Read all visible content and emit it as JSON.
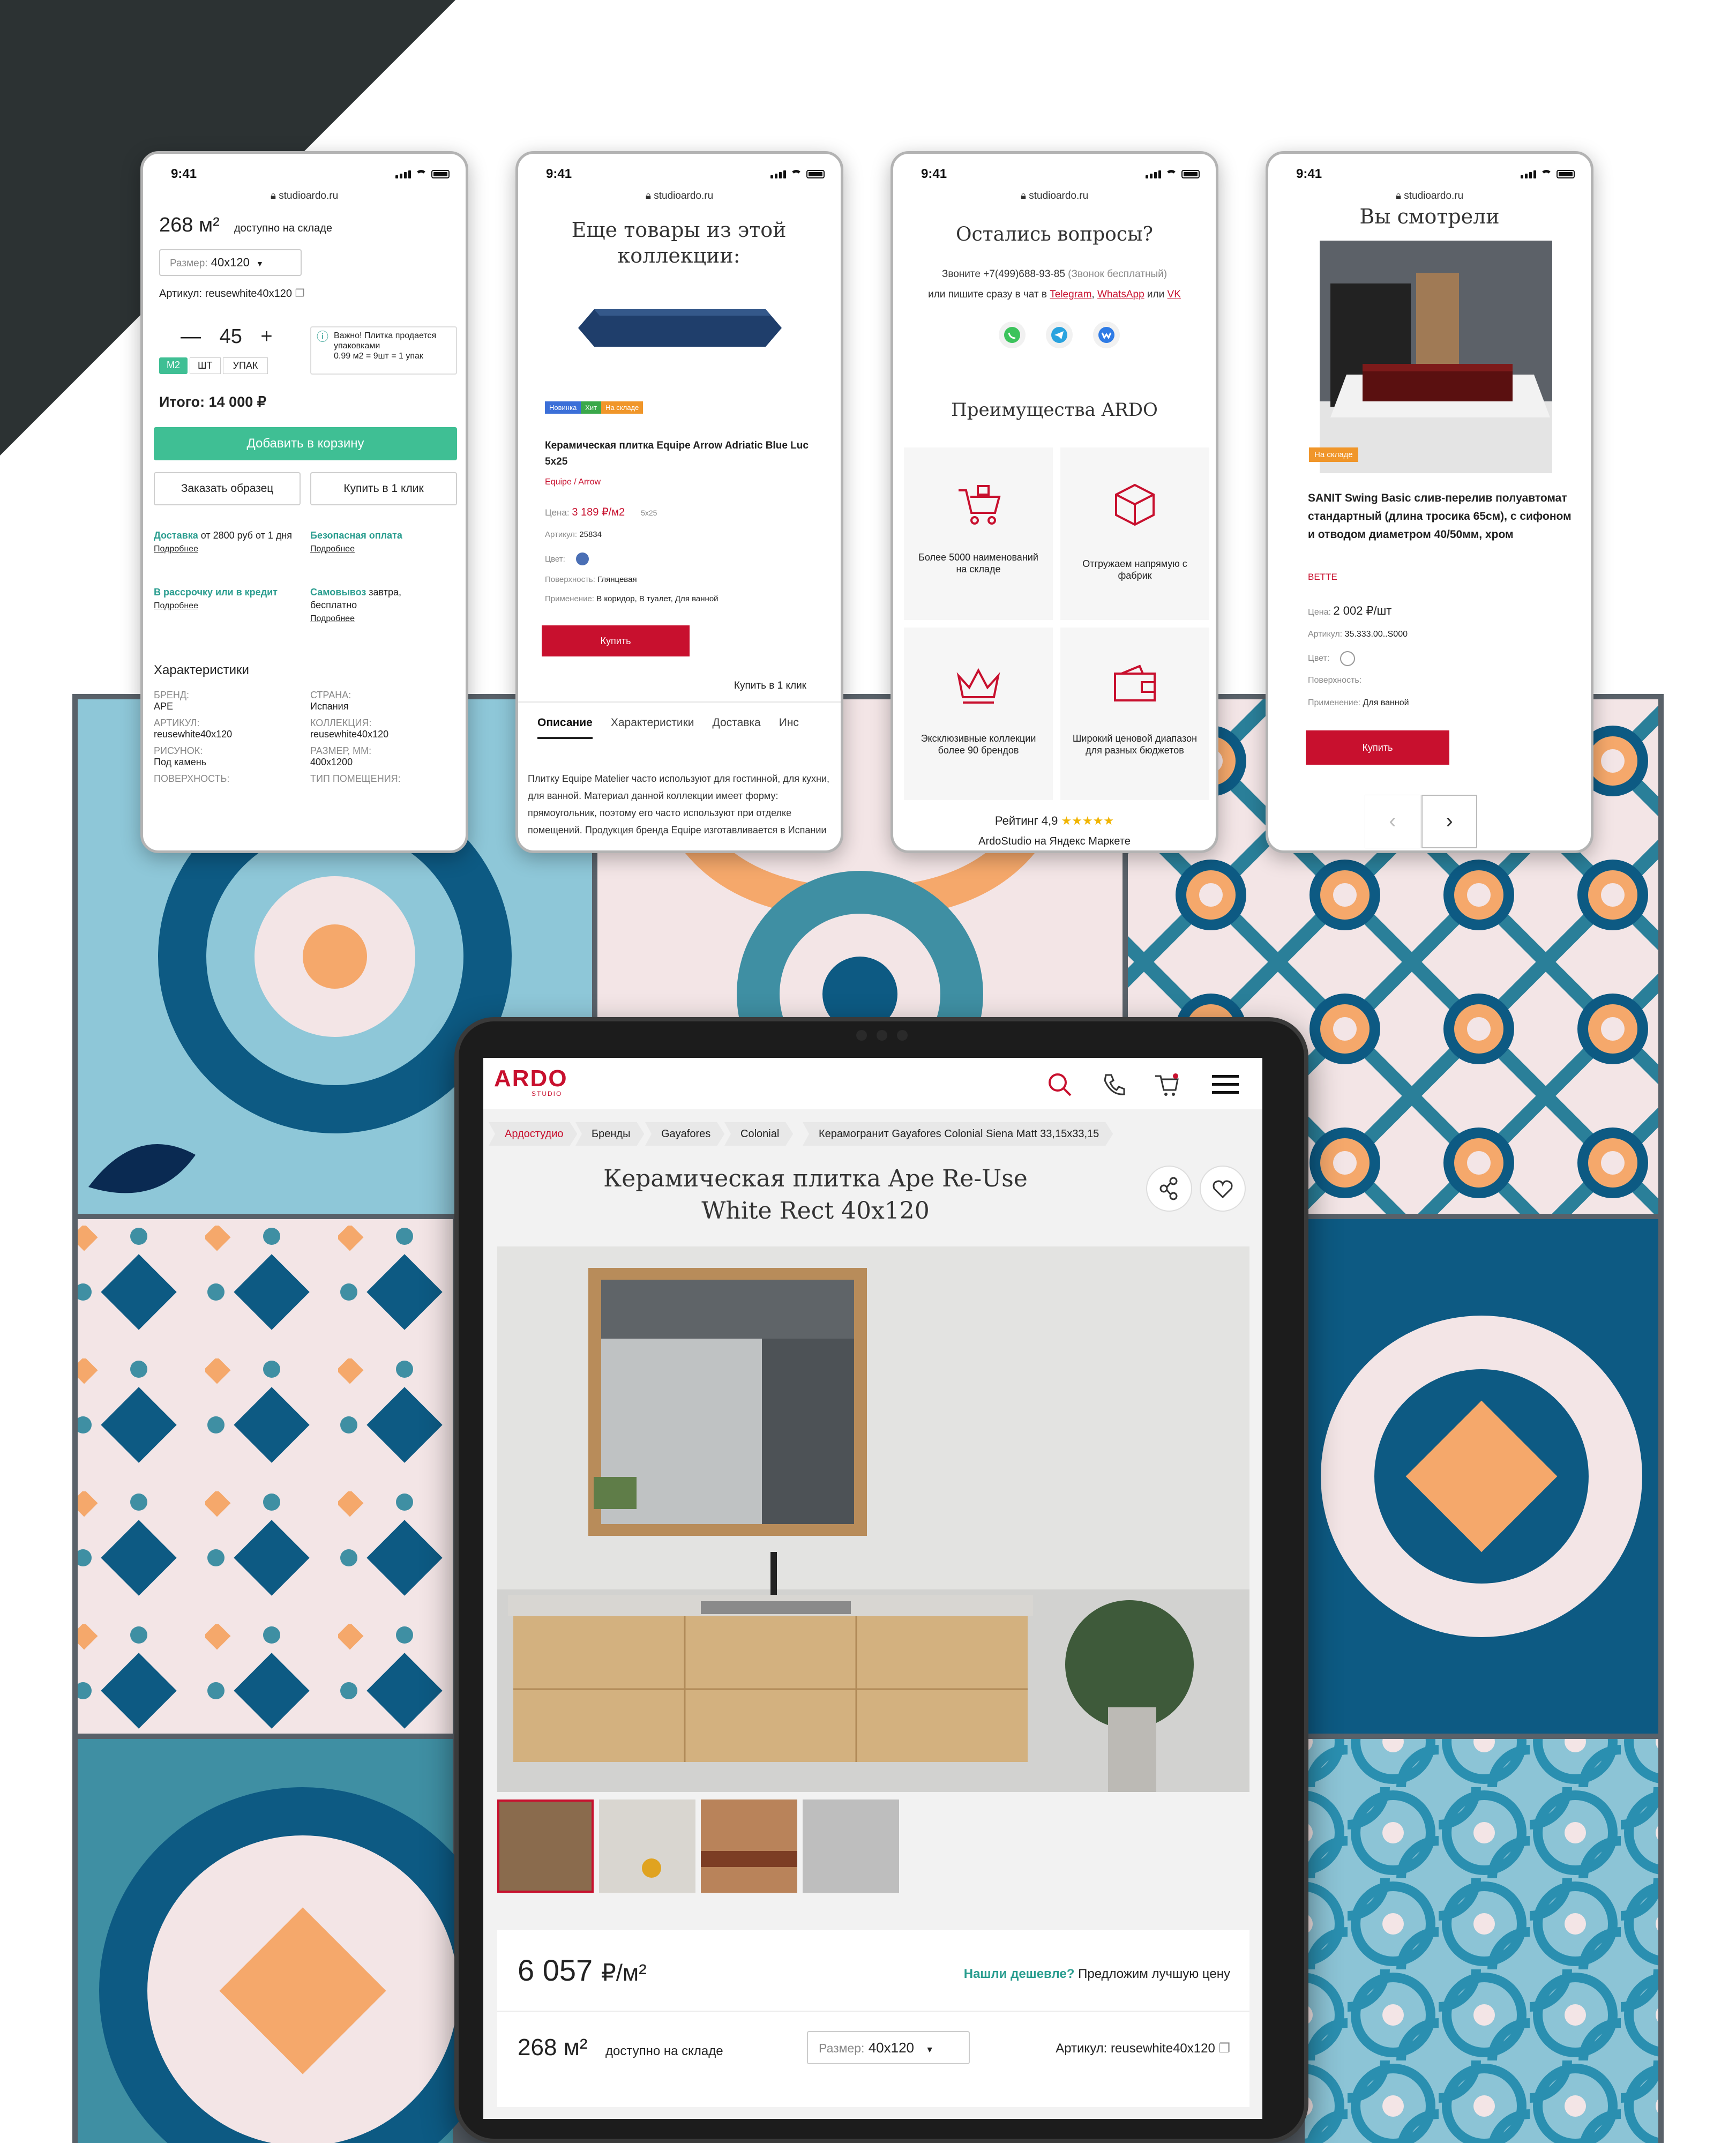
{
  "phones": {
    "status_time": "9:41",
    "url": "studioardo.ru",
    "p1": {
      "stock_qty": "268 м²",
      "stock_text": "доступно на складе",
      "size_label": "Размер:",
      "size_value": "40x120",
      "article": "Артикул: reusewhite40x120",
      "qty_minus": "—",
      "qty_value": "45",
      "qty_plus": "+",
      "units": [
        "М2",
        "ШТ",
        "УПАК"
      ],
      "notice_title": "Важно! Плитка продается упаковками",
      "notice_text": "0.99 м2 = 9шт = 1 упак",
      "total": "Итого: 14 000 ₽",
      "add_cart": "Добавить в корзину",
      "order_sample": "Заказать образец",
      "buy_one_click": "Купить в 1 клик",
      "features": [
        {
          "title": "Доставка",
          "text": " от 2800 руб от 1 дня",
          "link": "Подробнее"
        },
        {
          "title": "Безопасная оплата",
          "text": "",
          "link": "Подробнее"
        },
        {
          "title": "В рассрочку или в кредит",
          "text": "",
          "link": "Подробнее"
        },
        {
          "title": "Самовывоз",
          "text": " завтра, бесплатно",
          "link": "Подробнее"
        }
      ],
      "specs_title": "Характеристики",
      "specs": [
        {
          "k": "БРЕНД:",
          "v": "APE"
        },
        {
          "k": "СТРАНА:",
          "v": "Испания"
        },
        {
          "k": "АРТИКУЛ:",
          "v": "reusewhite40x120"
        },
        {
          "k": "КОЛЛЕКЦИЯ:",
          "v": "reusewhite40x120"
        },
        {
          "k": "РИСУНОК:",
          "v": "Под камень"
        },
        {
          "k": "РАЗМЕР, ММ:",
          "v": "400x1200"
        },
        {
          "k": "ПОВЕРХНОСТЬ:",
          "v": ""
        },
        {
          "k": "ТИП ПОМЕЩЕНИЯ:",
          "v": ""
        }
      ]
    },
    "p2": {
      "title": "Еще товары из этой коллекции:",
      "badges": [
        {
          "label": "Новинка",
          "color": "#3b6fd8"
        },
        {
          "label": "Хит",
          "color": "#3aa84a"
        },
        {
          "label": "На складе",
          "color": "#f0962a"
        }
      ],
      "product_name": "Керамическая плитка Equipe Arrow Adriatic Blue Luc 5x25",
      "brand": "Equipe / Arrow",
      "price_label": "Цена:",
      "price": "3 189 ₽/м2",
      "size": "5x25",
      "article_label": "Артикул:",
      "article": "25834",
      "color_label": "Цвет:",
      "surface_label": "Поверхность:",
      "surface": "Глянцевая",
      "usage_label": "Применение:",
      "usage": "В коридор, В туалет, Для ванной",
      "buy": "Купить",
      "buy_one_click": "Купить в 1 клик",
      "tabs": [
        "Описание",
        "Характеристики",
        "Доставка",
        "Инс"
      ],
      "description": "Плитку Equipe Matelier часто используют для гостинной, для кухни, для ванной. Материал данной коллекции имеет форму: прямоугольник, поэтому его часто используют при отделке помещений. Продукция бренда Equipe изготавливается в Испании"
    },
    "p3": {
      "title": "Остались вопросы?",
      "call_prefix": "Звоните ",
      "phone": "+7(499)688-93-85",
      "call_note": " (Звонок бесплатный)",
      "write_text": "или пишите сразу в чат  в ",
      "chats": [
        "Telegram",
        "WhatsApp",
        "VK"
      ],
      "or_word": " или ",
      "advantages_title": "Преимущества ARDO",
      "advantages": [
        {
          "icon": "cart-icon",
          "text": "Более 5000 наименований на складе"
        },
        {
          "icon": "box-icon",
          "text": "Отгружаем напрямую с фабрик"
        },
        {
          "icon": "crown-icon",
          "text": "Эксклюзивные коллекции более 90 брендов"
        },
        {
          "icon": "wallet-icon",
          "text": "Широкий ценовой диапазон для разных бюджетов"
        }
      ],
      "rating": "Рейтинг 4,9",
      "stars": "★★★★★",
      "rating_text": "ArdoStudio на Яндекс Маркете"
    },
    "p4": {
      "title": "Вы смотрели",
      "badge": "На складе",
      "product_name": "SANIT Swing Basic слив-перелив полуавтомат стандартный (длина тросика 65см), с сифоном и отводом диаметром 40/50мм, хром",
      "brand": "BETTE",
      "price_label": "Цена:",
      "price": "2 002 ₽/шт",
      "article_label": "Артикул:",
      "article": "35.333.00..S000",
      "color_label": "Цвет:",
      "surface_label": "Поверхность:",
      "usage_label": "Применение:",
      "usage": "Для ванной",
      "buy": "Купить"
    }
  },
  "tablet": {
    "logo": "ARDO",
    "logo_sub": "STUDIO",
    "breadcrumbs": [
      "Ардостудио",
      "Бренды",
      "Gayafores",
      "Colonial",
      "Керамогранит Gayafores Colonial Siena Matt 33,15x33,15"
    ],
    "title_line1": "Керамическая плитка Ape Re-Use",
    "title_line2": "White Rect 40x120",
    "price": "6 057",
    "price_unit": "₽/м²",
    "cheaper_link": "Нашли дешевле?",
    "cheaper_text": " Предложим лучшую цену",
    "stock_qty": "268 м²",
    "stock_text": "доступно на складе",
    "size_label": "Размер:",
    "size_value": "40x120",
    "article": "Артикул: reusewhite40x120"
  },
  "colors": {
    "accent_green": "#3fbf94",
    "brand_red": "#c8102e",
    "dark_corner": "#2c3233",
    "tile_blue": "#0d5a83",
    "tile_teal": "#3f8fa3",
    "tile_light": "#f3e5e6",
    "tile_orange": "#f5a86b"
  }
}
